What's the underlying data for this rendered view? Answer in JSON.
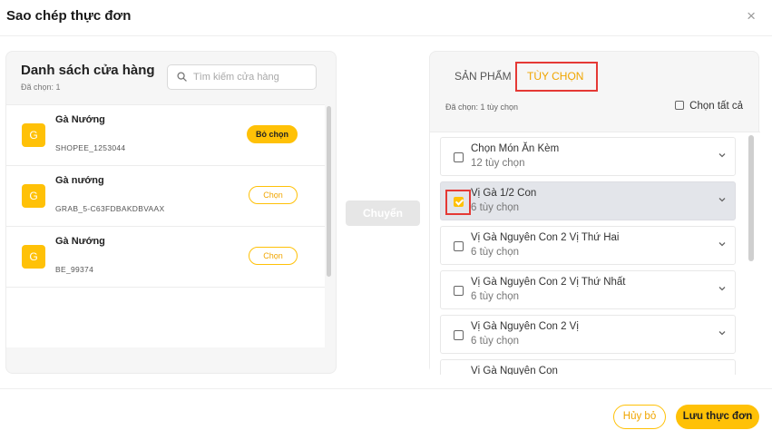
{
  "dialog": {
    "title": "Sao chép thực đơn",
    "close_label": "×"
  },
  "stores_panel": {
    "title": "Danh sách cửa hàng",
    "selected_count": "Đã chọn: 1",
    "search_placeholder": "Tìm kiếm cửa hàng",
    "stores": [
      {
        "avatar": "G",
        "name": "Gà Nướng",
        "code": "SHOPEE_1253044",
        "action": "Bỏ chọn",
        "selected": true
      },
      {
        "avatar": "G",
        "name": "Gà nướng",
        "code": "GRAB_5-C63FDBAKDBVAAX",
        "action": "Chọn",
        "selected": false
      },
      {
        "avatar": "G",
        "name": "Gà Nướng",
        "code": "BE_99374",
        "action": "Chọn",
        "selected": false
      }
    ]
  },
  "transfer_button": "Chuyển",
  "options_panel": {
    "tabs": [
      {
        "label": "SẢN PHẨM",
        "active": false
      },
      {
        "label": "TÙY CHỌN",
        "active": true
      }
    ],
    "selected_count": "Đã chọn: 1 tùy chọn",
    "select_all_label": "Chọn tất cả",
    "options": [
      {
        "name": "Chọn Món Ăn Kèm",
        "count": "12 tùy chọn",
        "checked": false
      },
      {
        "name": "Vị Gà 1/2 Con",
        "count": "6 tùy chọn",
        "checked": true
      },
      {
        "name": "Vị Gà Nguyên Con 2 Vị Thứ Hai",
        "count": "6 tùy chọn",
        "checked": false
      },
      {
        "name": "Vị Gà Nguyên Con 2 Vị Thứ Nhất",
        "count": "6 tùy chọn",
        "checked": false
      },
      {
        "name": "Vị Gà Nguyên Con 2 Vị",
        "count": "6 tùy chọn",
        "checked": false
      },
      {
        "name": "Vị Gà Nguyên Con",
        "count": "",
        "checked": false
      }
    ]
  },
  "footer": {
    "cancel_label": "Hủy bỏ",
    "save_label": "Lưu thực đơn"
  },
  "colors": {
    "accent": "#ffc107",
    "accent_text": "#f0a500",
    "highlight_box": "#e53935",
    "selected_row": "#e3e5ea"
  }
}
